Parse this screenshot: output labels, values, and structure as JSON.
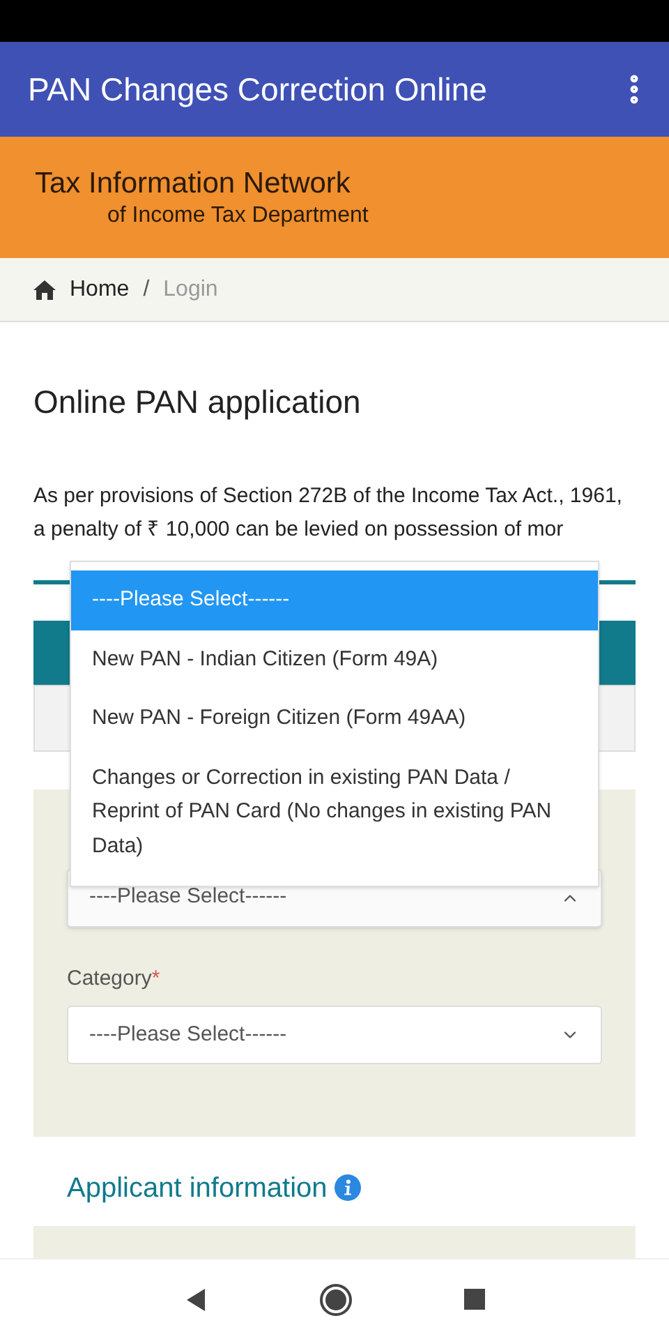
{
  "app_bar": {
    "title": "PAN Changes Correction Online"
  },
  "banner": {
    "line_1": "Tax Information Network",
    "line_2": "of Income Tax Department"
  },
  "breadcrumb": {
    "separator": "/",
    "items": [
      {
        "label": "Home",
        "selected": false
      },
      {
        "label": "Login",
        "selected": true
      }
    ]
  },
  "page_title": "Online PAN application",
  "notice": "As per provisions of Section 272B of the Income Tax Act., 1961, a penalty of ₹ 10,000 can be levied on possession of mor",
  "application_type": {
    "value": "----Please Select------",
    "expanded": true,
    "options": [
      {
        "label": "----Please Select------",
        "selected": true
      },
      {
        "label": "New PAN - Indian Citizen (Form 49A)",
        "selected": false
      },
      {
        "label": "New PAN - Foreign Citizen (Form 49AA)",
        "selected": false
      },
      {
        "label": "Changes or Correction in existing PAN Data / Reprint of PAN Card (No changes in existing PAN Data)",
        "selected": false
      }
    ]
  },
  "category": {
    "label": "Category",
    "required_mark": "*",
    "value": "----Please Select------",
    "expanded": false
  },
  "section_heading": "Applicant information"
}
